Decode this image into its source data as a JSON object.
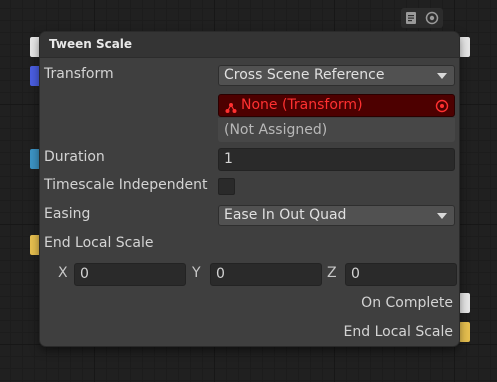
{
  "node": {
    "title": "Tween Scale"
  },
  "fields": {
    "transform": {
      "label": "Transform",
      "dropdown_value": "Cross Scene Reference",
      "reference_value": "None (Transform)",
      "unassigned_text": "(Not Assigned)"
    },
    "duration": {
      "label": "Duration",
      "value": "1"
    },
    "timescale_independent": {
      "label": "Timescale Independent",
      "checked": false
    },
    "easing": {
      "label": "Easing",
      "value": "Ease In Out Quad"
    },
    "end_local_scale": {
      "label": "End Local Scale",
      "x_label": "X",
      "x_value": "0",
      "y_label": "Y",
      "y_value": "0",
      "z_label": "Z",
      "z_value": "0"
    }
  },
  "outputs": {
    "on_complete": "On Complete",
    "end_local_scale": "End Local Scale"
  },
  "icons": {
    "top": [
      "note-icon",
      "settings-circle-icon"
    ],
    "reference": "cross-scene-icon",
    "target": "target-icon"
  },
  "colors": {
    "port_flow": "#e6e6e6",
    "port_transform": "#4a5ee0",
    "port_float": "#3c93c4",
    "port_vector": "#e6bf4f",
    "error_bg": "#4d0000",
    "error_text": "#ff3030"
  }
}
